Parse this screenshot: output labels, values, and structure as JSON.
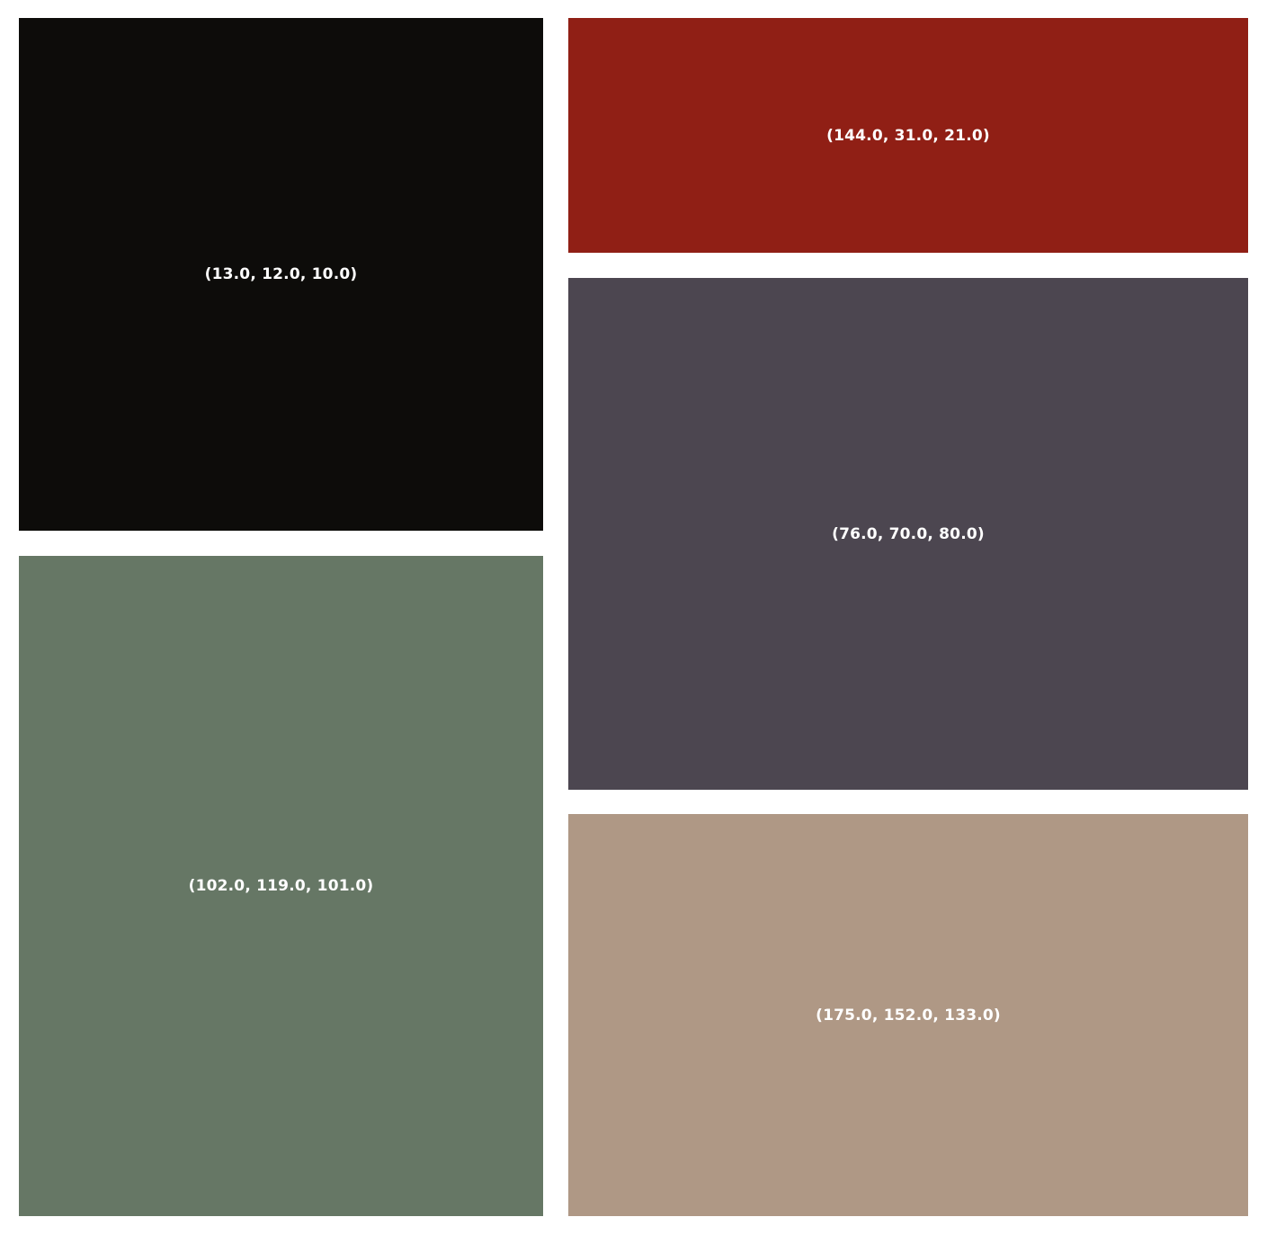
{
  "swatches": [
    {
      "label": "(13.0, 12.0, 10.0)",
      "color": "#0d0c0a"
    },
    {
      "label": "(144.0, 31.0, 21.0)",
      "color": "#901f15"
    },
    {
      "label": "(76.0, 70.0, 80.0)",
      "color": "#4c4650"
    },
    {
      "label": "(102.0, 119.0, 101.0)",
      "color": "#667765"
    },
    {
      "label": "(175.0, 152.0, 133.0)",
      "color": "#af9885"
    }
  ]
}
